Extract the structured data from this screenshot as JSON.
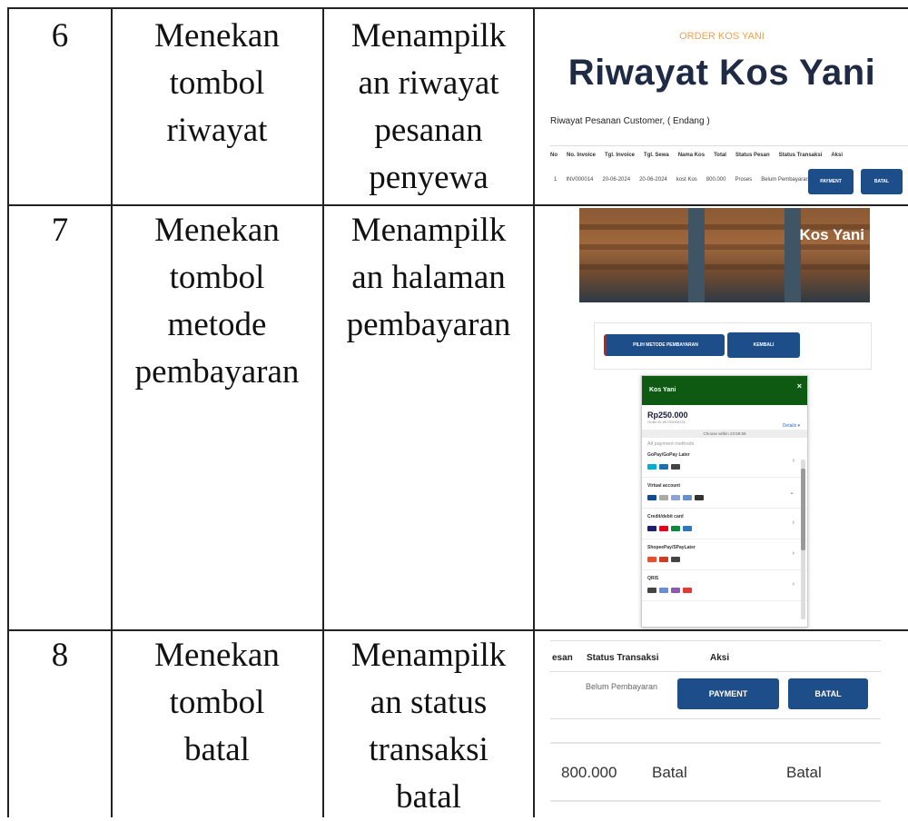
{
  "rows": [
    {
      "no": "6",
      "action": [
        "Menekan",
        "tombol",
        "riwayat"
      ],
      "result": [
        "Menampilk",
        "an riwayat",
        "pesanan",
        "penyewa"
      ]
    },
    {
      "no": "7",
      "action": [
        "Menekan",
        "tombol",
        "metode",
        "pembayaran"
      ],
      "result": [
        "Menampilk",
        "an halaman",
        "pembayaran"
      ]
    },
    {
      "no": "8",
      "action": [
        "Menekan",
        "tombol",
        "batal"
      ],
      "result": [
        "Menampilk",
        "an status",
        "transaksi",
        "batal"
      ]
    }
  ],
  "shot6": {
    "brand": "ORDER KOS YANI",
    "title": "Riwayat Kos Yani",
    "subtitle": "Riwayat Pesanan Customer, ( Endang )",
    "headers": [
      "No",
      "No. Invoice",
      "Tgl. Invoice",
      "Tgl. Sewa",
      "Nama Kos",
      "Total",
      "Status Pesan",
      "Status Transaksi",
      "Aksi"
    ],
    "row": [
      "1",
      "INV000014",
      "20-06-2024",
      "20-06-2024",
      "kost Kos",
      "800.000",
      "Proses",
      "Belum Pembayaran"
    ],
    "btn_payment": "PAYMENT",
    "btn_batal": "BATAL"
  },
  "shot7": {
    "hero_name": "Kos Yani",
    "btn_metode": "PILIH METODE PEMBAYARAN",
    "btn_kembali": "KEMBALI",
    "pay_header": "Kos Yani",
    "close": "×",
    "amount": "Rp250.000",
    "order_id": "Order ID #KY00000231",
    "details": "Details ▾",
    "choose": "Choose within 23:59:59",
    "all_methods": "All payment methods",
    "methods": [
      "GoPay/GoPay Later",
      "Virtual account",
      "Credit/debit card",
      "ShopeePay/SPayLater",
      "QRIS"
    ],
    "chevrons": [
      "›",
      "⌄",
      "›",
      "›",
      "›"
    ],
    "colors": {
      "header": "#0f5a12",
      "button": "#1d4e89"
    }
  },
  "shot8": {
    "col_esan": "esan",
    "col_status": "Status Transaksi",
    "col_aksi": "Aksi",
    "status": "Belum Pembayaran",
    "btn_payment": "PAYMENT",
    "btn_batal": "BATAL",
    "total": "800.000",
    "status_pesan": "Batal",
    "status_transaksi": "Batal"
  }
}
